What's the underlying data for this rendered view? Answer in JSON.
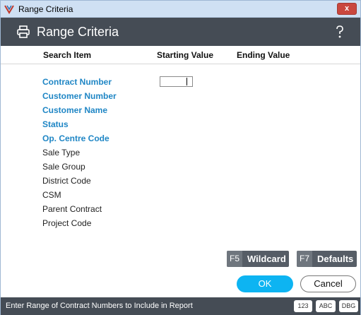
{
  "window": {
    "title": "Range Criteria",
    "close_label": "x"
  },
  "header": {
    "title": "Range Criteria",
    "help_label": "?"
  },
  "columns": {
    "search_item": "Search Item",
    "starting_value": "Starting Value",
    "ending_value": "Ending Value"
  },
  "criteria": {
    "items": [
      {
        "label": "Contract Number"
      },
      {
        "label": "Customer Number"
      },
      {
        "label": "Customer Name"
      },
      {
        "label": "Status"
      },
      {
        "label": "Op. Centre Code"
      },
      {
        "label": "Sale Type"
      },
      {
        "label": "Sale Group"
      },
      {
        "label": "District Code"
      },
      {
        "label": "CSM"
      },
      {
        "label": "Parent Contract"
      },
      {
        "label": "Project Code"
      }
    ],
    "starting_value": ""
  },
  "function_buttons": {
    "wildcard": {
      "key": "F5",
      "label": "Wildcard"
    },
    "defaults": {
      "key": "F7",
      "label": "Defaults"
    }
  },
  "actions": {
    "ok": "OK",
    "cancel": "Cancel"
  },
  "status_bar": {
    "message": "Enter Range of Contract Numbers to Include in Report",
    "modes": [
      "123",
      "ABC",
      "DBG"
    ]
  },
  "colors": {
    "accent_blue": "#1f86c5",
    "ok_button": "#0db4f2",
    "header_bg": "#454c55",
    "title_bar": "#cfe0f3",
    "close_button": "#c9473e"
  }
}
